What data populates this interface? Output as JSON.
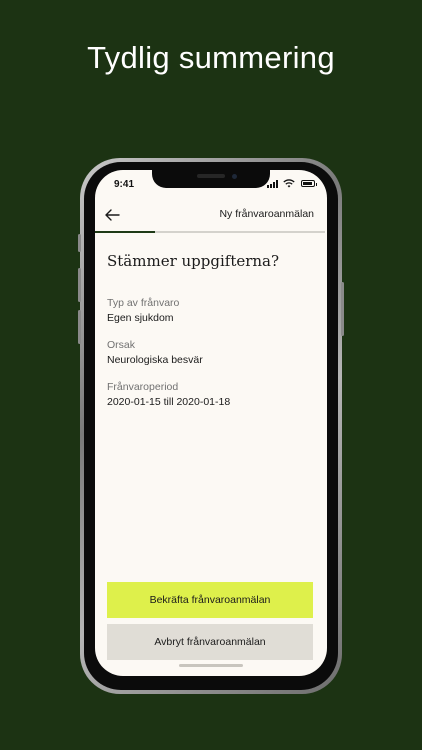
{
  "headline": "Tydlig summering",
  "status_bar": {
    "time": "9:41",
    "icons": [
      "signal-icon",
      "wifi-icon",
      "battery-icon"
    ]
  },
  "nav": {
    "back_icon": "arrow-left-icon",
    "title": "Ny frånvaroanmälan"
  },
  "progress": {
    "fraction": 0.26
  },
  "summary": {
    "heading": "Stämmer uppgifterna?",
    "fields": [
      {
        "label": "Typ av frånvaro",
        "value": "Egen sjukdom"
      },
      {
        "label": "Orsak",
        "value": "Neurologiska besvär"
      },
      {
        "label": "Frånvaroperiod",
        "value": "2020-01-15 till 2020-01-18"
      }
    ]
  },
  "actions": {
    "confirm_label": "Bekräfta frånvaroanmälan",
    "cancel_label": "Avbryt frånvaroanmälan"
  },
  "colors": {
    "background": "#1c3313",
    "screen": "#fcf9f4",
    "accent": "#def04b",
    "secondary_button": "#e0ddd6",
    "progress": "#1e3a16"
  }
}
